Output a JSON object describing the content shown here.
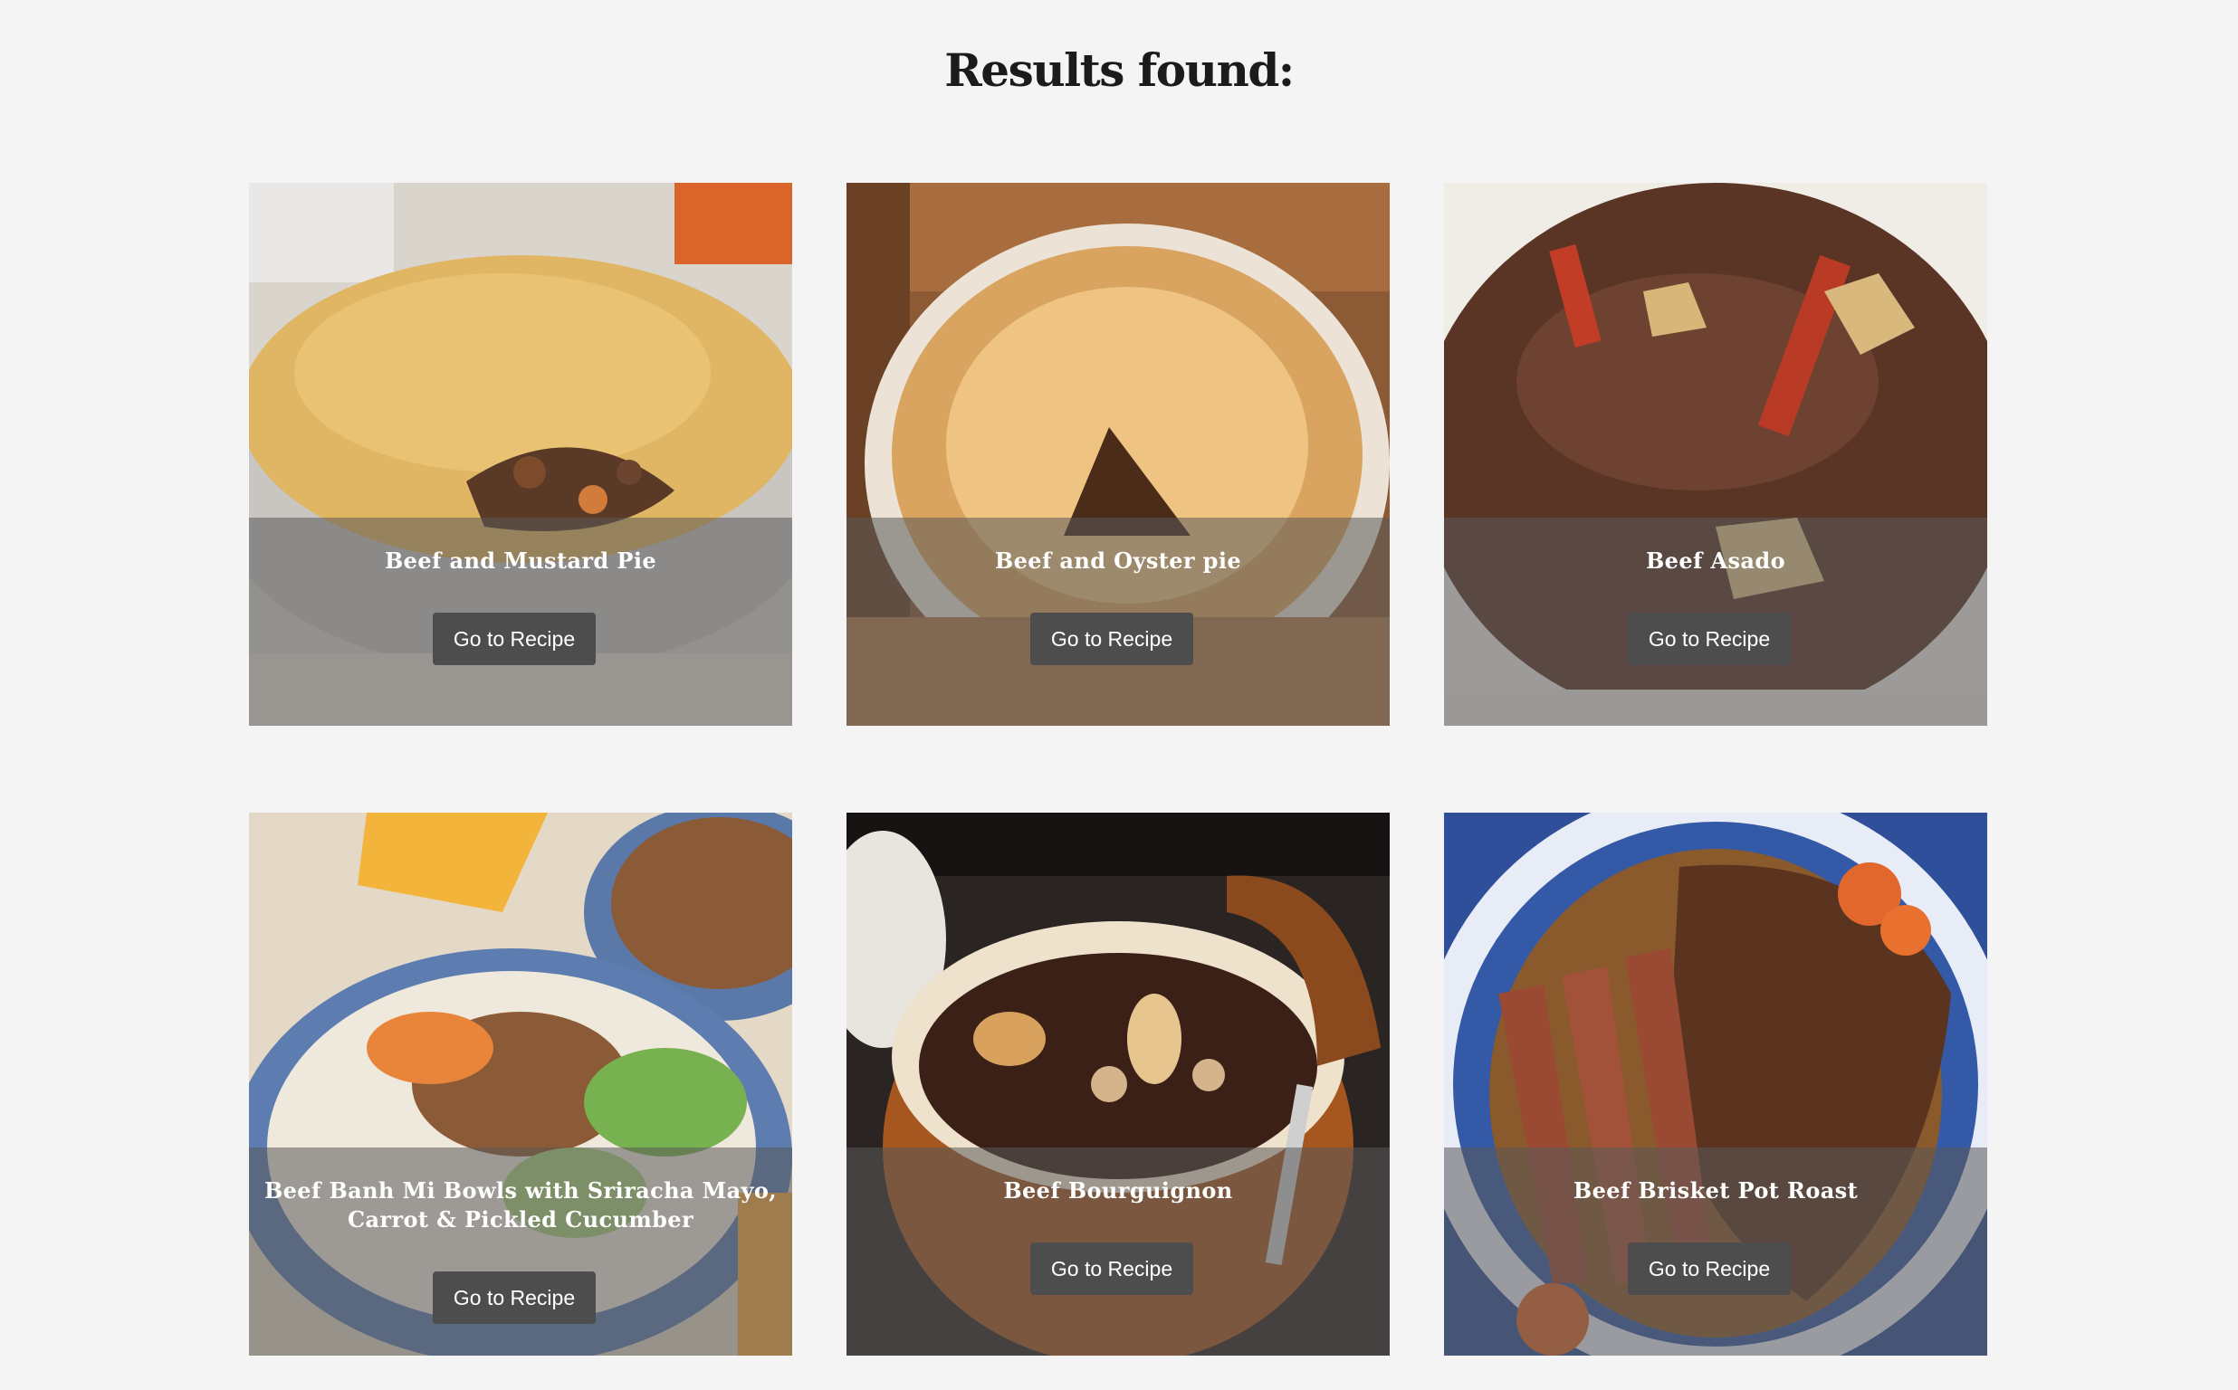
{
  "page": {
    "title": "Results found:"
  },
  "recipes": [
    {
      "title": "Beef and Mustard Pie",
      "button": "Go to Recipe",
      "image": "beef-and-mustard-pie-photo"
    },
    {
      "title": "Beef and Oyster pie",
      "button": "Go to Recipe",
      "image": "beef-and-oyster-pie-photo"
    },
    {
      "title": "Beef Asado",
      "button": "Go to Recipe",
      "image": "beef-asado-photo"
    },
    {
      "title": "Beef Banh Mi Bowls with Sriracha Mayo, Carrot & Pickled Cucumber",
      "button": "Go to Recipe",
      "image": "beef-banh-mi-bowls-photo"
    },
    {
      "title": "Beef Bourguignon",
      "button": "Go to Recipe",
      "image": "beef-bourguignon-photo"
    },
    {
      "title": "Beef Brisket Pot Roast",
      "button": "Go to Recipe",
      "image": "beef-brisket-pot-roast-photo"
    }
  ]
}
